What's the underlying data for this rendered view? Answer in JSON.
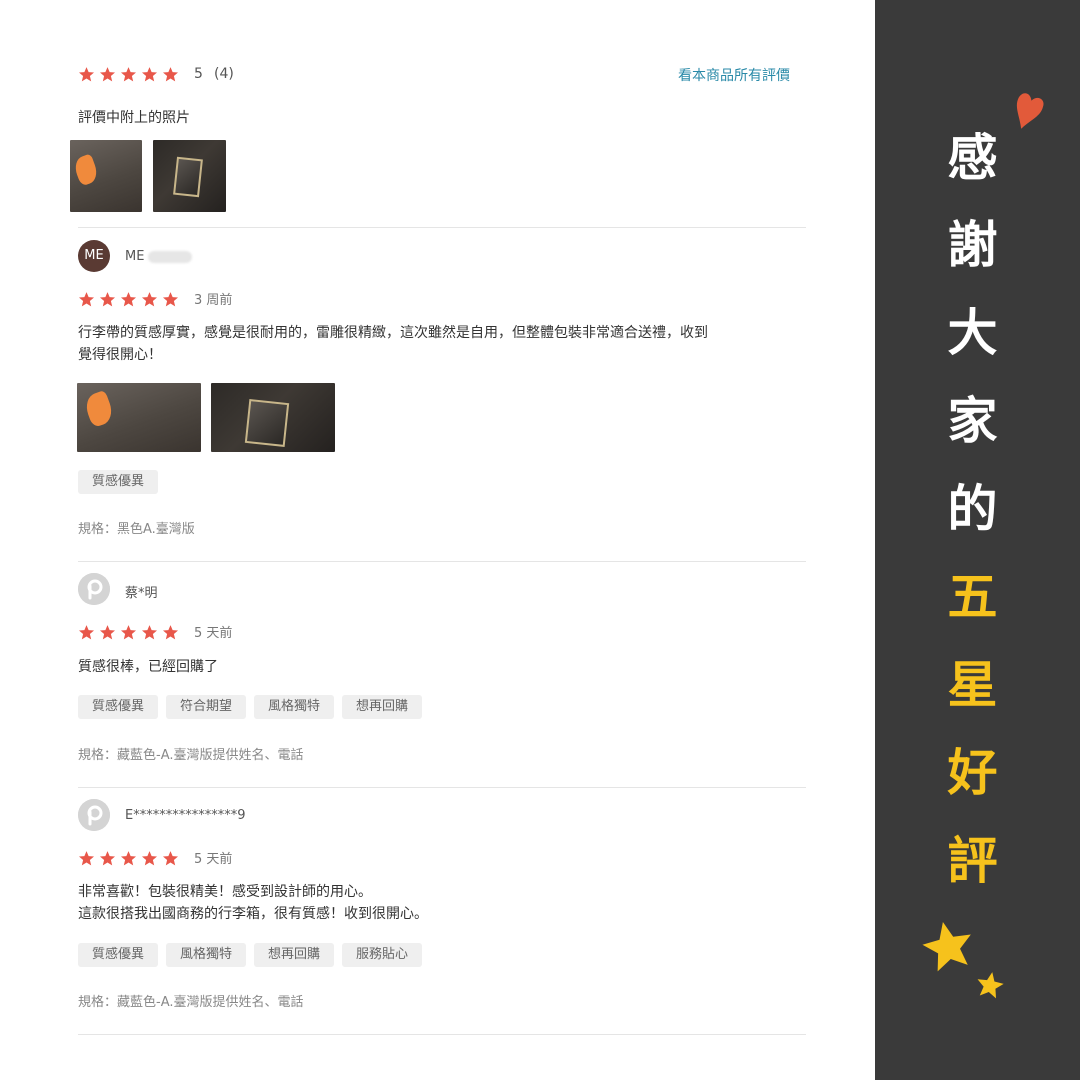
{
  "colors": {
    "star": "#e8574a",
    "link": "#2a8aa8",
    "sidebar_bg": "#3a3a3a",
    "accent_yellow": "#f6c21c",
    "heart": "#e25a3a"
  },
  "summary": {
    "score": "5",
    "count": "(4)",
    "all_reviews_link": "看本商品所有評價"
  },
  "photo_section": {
    "title": "評價中附上的照片"
  },
  "reviews": [
    {
      "avatar_text": "ME",
      "username": "ME",
      "time_ago": "3 周前",
      "text_lines": [
        "行李帶的質感厚實，感覺是很耐用的，雷雕很精緻，這次雖然是自用，但整體包裝非常適合送禮，收到",
        "覺得很開心！"
      ],
      "tags": [
        "質感優異"
      ],
      "spec": "規格：黑色A.臺灣版"
    },
    {
      "avatar_text": "",
      "username": "蔡*明",
      "time_ago": "5 天前",
      "text_lines": [
        "質感很棒，已經回購了"
      ],
      "tags": [
        "質感優異",
        "符合期望",
        "風格獨特",
        "想再回購"
      ],
      "spec": "規格：藏藍色-A.臺灣版提供姓名、電話"
    },
    {
      "avatar_text": "",
      "username": "E****************9",
      "time_ago": "5 天前",
      "text_lines": [
        "非常喜歡！包裝很精美！感受到設計師的用心。",
        "這款很搭我出國商務的行李箱，很有質感！收到很開心。"
      ],
      "tags": [
        "質感優異",
        "風格獨特",
        "想再回購",
        "服務貼心"
      ],
      "spec": "規格：藏藍色-A.臺灣版提供姓名、電話"
    }
  ],
  "banner": {
    "chars": [
      "感",
      "謝",
      "大",
      "家",
      "的",
      "五",
      "星",
      "好",
      "評"
    ]
  },
  "icons": {
    "star": "star-icon",
    "heart": "heart-icon",
    "avatar_placeholder": "p-logo-icon"
  }
}
